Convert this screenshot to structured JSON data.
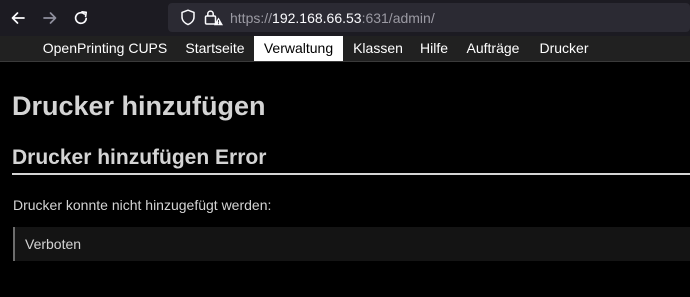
{
  "browser": {
    "back_icon": "arrow-left-icon",
    "forward_icon": "arrow-right-icon",
    "reload_icon": "reload-icon",
    "tracking_icon": "shield-icon",
    "security_icon": "lock-warning-icon",
    "url_scheme": "https://",
    "url_host": "192.168.66.53",
    "url_rest": ":631/admin/"
  },
  "site_nav": {
    "items": [
      {
        "label": "OpenPrinting CUPS",
        "active": false
      },
      {
        "label": "Startseite",
        "active": false
      },
      {
        "label": "Verwaltung",
        "active": true
      },
      {
        "label": "Klassen",
        "active": false
      },
      {
        "label": "Hilfe",
        "active": false
      },
      {
        "label": "Aufträge",
        "active": false
      },
      {
        "label": "Drucker",
        "active": false
      }
    ]
  },
  "main": {
    "title": "Drucker hinzufügen",
    "section_title": "Drucker hinzufügen Error",
    "message": "Drucker konnte nicht hinzugefügt werden:",
    "error_detail": "Verboten"
  },
  "colors": {
    "background": "#000000",
    "nav_background": "#212121",
    "active_tab_background": "#ffffff",
    "text": "#d4d4d4"
  }
}
